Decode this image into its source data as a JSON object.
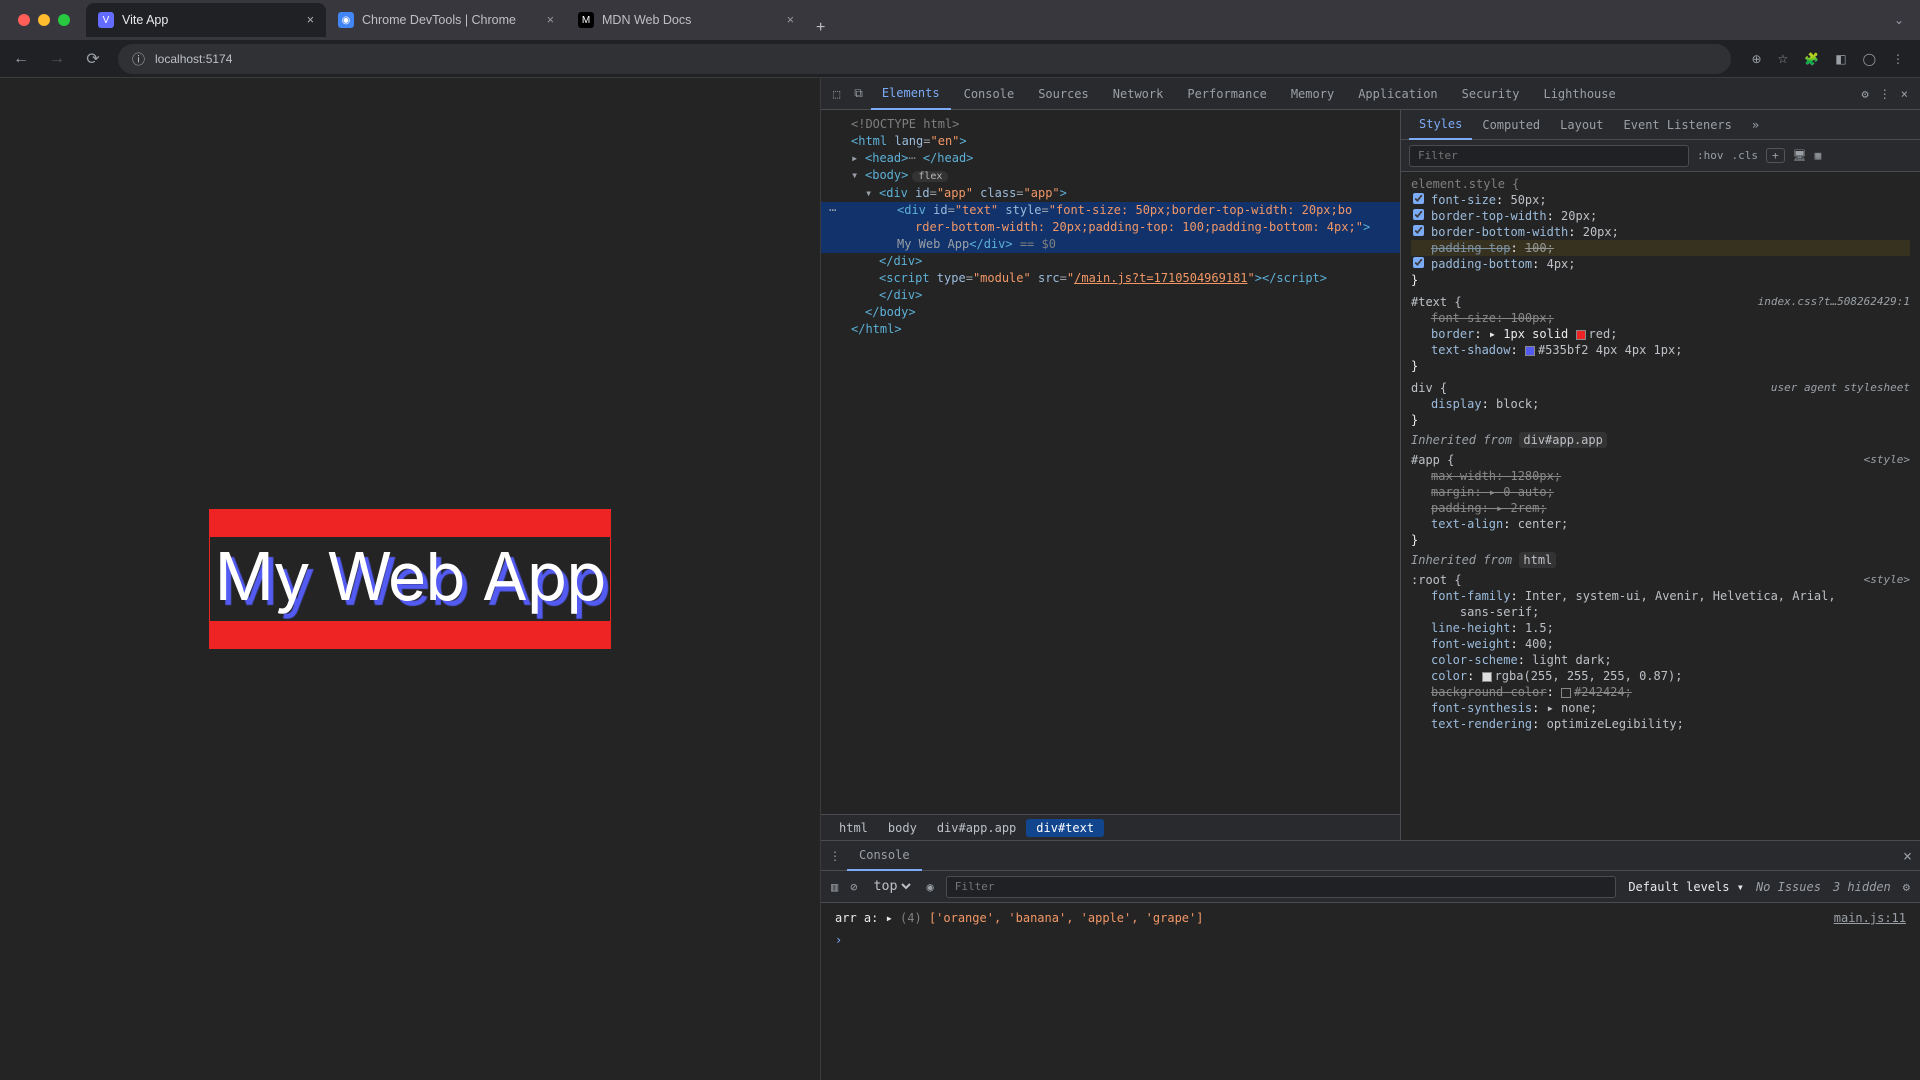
{
  "browser": {
    "tabs": [
      {
        "title": "Vite App",
        "favicon": "V",
        "faviconBg": "#646cff",
        "active": true
      },
      {
        "title": "Chrome DevTools | Chrome",
        "favicon": "◉",
        "faviconBg": "#555",
        "active": false
      },
      {
        "title": "MDN Web Docs",
        "favicon": "M",
        "faviconBg": "#000",
        "active": false
      }
    ],
    "url": "localhost:5174"
  },
  "page": {
    "rendered_text": "My Web App"
  },
  "devtools": {
    "main_tabs": [
      "Elements",
      "Console",
      "Sources",
      "Network",
      "Performance",
      "Memory",
      "Application",
      "Security",
      "Lighthouse"
    ],
    "main_active": "Elements",
    "dom": {
      "line0": "<!DOCTYPE html>",
      "line1_open": "<html ",
      "line1_attr": "lang",
      "line1_val": "\"en\"",
      "line1_close": ">",
      "line_head": "<head>",
      "line_head_dots": "⋯",
      "line_head_close": "</head>",
      "line_body": "<body>",
      "line_body_pill": "flex",
      "line_app": "<div id=\"app\" class=\"app\">",
      "line_text1": "<div id=\"text\" style=\"",
      "line_text1_style": "font-size: 50px;border-top-width: 20px;bo",
      "line_text2_style": "rder-bottom-width: 20px;padding-top: 100;padding-bottom: 4px;",
      "line_text2_close": "\">",
      "line_text_content": "My Web App",
      "line_text_closediv": "</div>",
      "line_text_eq": " == $0",
      "line_closediv_inner": "</div>",
      "line_script_1": "<script type=\"module\" src=\"",
      "line_script_src": "/main.js?t=1710504969181",
      "line_script_2": "\"></script>",
      "line_closediv_app": "</div>",
      "line_closebody": "</body>",
      "line_closehtml": "</html>"
    },
    "crumbs": [
      "html",
      "body",
      "div#app.app",
      "div#text"
    ],
    "styles_tabs": [
      "Styles",
      "Computed",
      "Layout",
      "Event Listeners"
    ],
    "styles_active": "Styles",
    "filter_placeholder": "Filter",
    "filter_buttons": [
      ":hov",
      ".cls",
      "+"
    ],
    "rules": {
      "element_style": {
        "selector": "element.style {",
        "props": [
          {
            "k": "font-size",
            "v": "50px;",
            "cb": true
          },
          {
            "k": "border-top-width",
            "v": "20px;",
            "cb": true
          },
          {
            "k": "border-bottom-width",
            "v": "20px;",
            "cb": true
          },
          {
            "k": "padding-top",
            "v": "100;",
            "cb": false,
            "invalid": true
          },
          {
            "k": "padding-bottom",
            "v": "4px;",
            "cb": true
          }
        ]
      },
      "text_rule": {
        "selector": "#text {",
        "source": "index.css?t…508262429:1",
        "props": [
          {
            "k": "font-size",
            "v": "100px;",
            "strike": true
          },
          {
            "k": "border",
            "v": "▸ 1px solid ",
            "swatch": "#ed2324",
            "swname": "red;"
          },
          {
            "k": "text-shadow",
            "v": "",
            "swatch": "#535bf2",
            "swname": "#535bf2 4px 4px 1px;"
          }
        ]
      },
      "div_rule": {
        "selector": "div {",
        "source": "user agent stylesheet",
        "props": [
          {
            "k": "display",
            "v": "block;"
          }
        ]
      },
      "inherited_app": "Inherited from ",
      "inherited_app_sel": "div#app.app",
      "app_rule": {
        "selector": "#app {",
        "source": "<style>",
        "props": [
          {
            "k": "max-width",
            "v": "1280px;",
            "strike": true
          },
          {
            "k": "margin",
            "v": "▸ 0 auto;",
            "strike": true
          },
          {
            "k": "padding",
            "v": "▸ 2rem;",
            "strike": true
          },
          {
            "k": "text-align",
            "v": "center;"
          }
        ]
      },
      "inherited_html": "Inherited from ",
      "inherited_html_sel": "html",
      "root_rule": {
        "selector": ":root {",
        "source": "<style>",
        "props": [
          {
            "k": "font-family",
            "v": "Inter, system-ui, Avenir, Helvetica, Arial,"
          },
          {
            "k": "",
            "v": "    sans-serif;"
          },
          {
            "k": "line-height",
            "v": "1.5;"
          },
          {
            "k": "font-weight",
            "v": "400;"
          },
          {
            "k": "color-scheme",
            "v": "light dark;"
          },
          {
            "k": "color",
            "v": "",
            "swatch": "#dedede",
            "swname": "rgba(255, 255, 255, 0.87);"
          },
          {
            "k": "background-color",
            "v": "",
            "swatch": "#242424",
            "swname": "#242424;",
            "strike": true
          },
          {
            "k": "font-synthesis",
            "v": "▸ none;"
          },
          {
            "k": "text-rendering",
            "v": "optimizeLegibility;"
          }
        ]
      }
    },
    "drawer": {
      "tab": "Console",
      "context": "top",
      "filter_placeholder": "Filter",
      "levels": "Default levels",
      "issues": "No Issues",
      "hidden": "3 hidden",
      "log_prefix": "arr a: ",
      "log_count": "(4) ",
      "log_array": "['orange', 'banana', 'apple', 'grape']",
      "log_src": "main.js:11"
    }
  }
}
